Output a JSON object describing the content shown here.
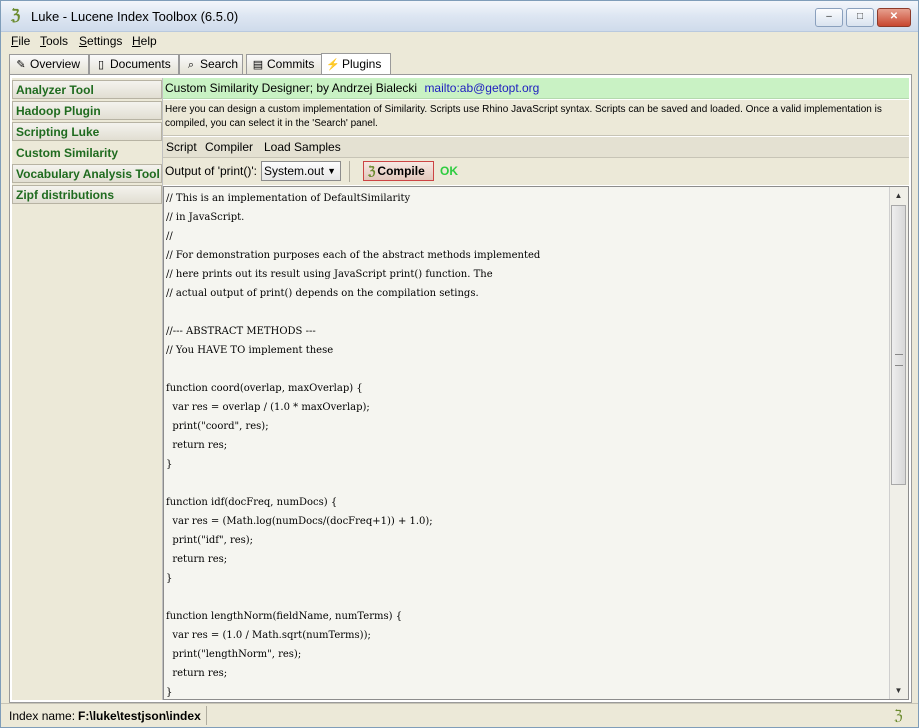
{
  "window": {
    "title": "Luke - Lucene Index Toolbox (6.5.0)",
    "icon": "luke-app-icon",
    "controls": {
      "minimize": "–",
      "maximize": "□",
      "close": "✕"
    }
  },
  "menu": {
    "items": [
      {
        "label": "File",
        "mnemonic": "F"
      },
      {
        "label": "Tools",
        "mnemonic": "T"
      },
      {
        "label": "Settings",
        "mnemonic": "S"
      },
      {
        "label": "Help",
        "mnemonic": "H"
      }
    ]
  },
  "tabs": [
    {
      "label": "Overview",
      "icon": "overview-icon"
    },
    {
      "label": "Documents",
      "icon": "documents-icon"
    },
    {
      "label": "Search",
      "icon": "search-icon"
    },
    {
      "label": "Commits",
      "icon": "commits-icon"
    },
    {
      "label": "Plugins",
      "icon": "plugins-icon",
      "active": true
    }
  ],
  "sidebar": {
    "items": [
      {
        "label": "Analyzer Tool"
      },
      {
        "label": "Hadoop Plugin"
      },
      {
        "label": "Scripting Luke"
      },
      {
        "label": "Custom Similarity",
        "active": true
      },
      {
        "label": "Vocabulary Analysis Tool"
      },
      {
        "label": "Zipf distributions"
      }
    ],
    "text_color": "#1f6b1f"
  },
  "plugin": {
    "header": "Custom Similarity Designer; by Andrzej Bialecki",
    "mail": "mailto:ab@getopt.org",
    "header_bg": "#c9f2c4",
    "description": "Here you can design a custom implementation of Similarity. Scripts use Rhino JavaScript syntax. Scripts can be saved and loaded. Once a valid implementation is compiled, you can select it in the 'Search' panel.",
    "subtabs": [
      "Script",
      "Compiler",
      "Load Samples"
    ],
    "output_label": "Output of 'print()':",
    "output_value": "System.out",
    "compile_label": "Compile",
    "status": "OK",
    "status_color": "#2ecc40"
  },
  "code_lines": [
    "// This is an implementation of DefaultSimilarity",
    "// in JavaScript.",
    "//",
    "// For demonstration purposes each of the abstract methods implemented",
    "// here prints out its result using JavaScript print() function. The",
    "// actual output of print() depends on the compilation setings.",
    "",
    "//--- ABSTRACT METHODS ---",
    "// You HAVE TO implement these",
    "",
    "function coord(overlap, maxOverlap) {",
    "  var res = overlap / (1.0 * maxOverlap);",
    "  print(\"coord\", res);",
    "  return res;",
    "}",
    "",
    "function idf(docFreq, numDocs) {",
    "  var res = (Math.log(numDocs/(docFreq+1)) + 1.0);",
    "  print(\"idf\", res);",
    "  return res;",
    "}",
    "",
    "function lengthNorm(fieldName, numTerms) {",
    "  var res = (1.0 / Math.sqrt(numTerms));",
    "  print(\"lengthNorm\", res);",
    "  return res;",
    "}"
  ],
  "statusbar": {
    "label": "Index name:",
    "value": "F:\\luke\\testjson\\index"
  }
}
